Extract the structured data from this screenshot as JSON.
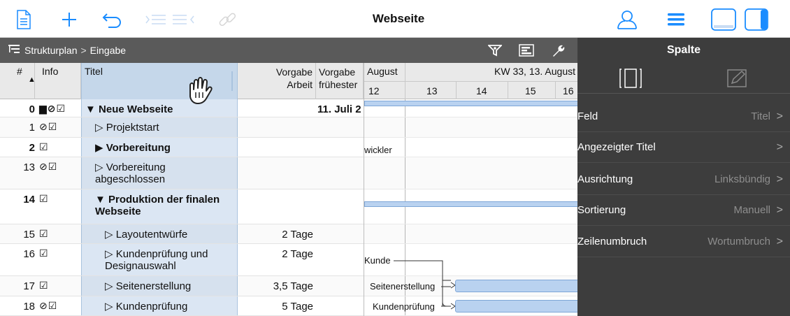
{
  "document": {
    "title": "Webseite"
  },
  "toolbar": {
    "left_icons": [
      "document-icon",
      "add-icon",
      "undo-icon",
      "indent-outdent-icon",
      "link-icon"
    ],
    "right_icons": [
      "resources-icon",
      "menu-icon",
      "bottom-pane-icon",
      "right-pane-icon"
    ],
    "accent_color": "#1a8cff"
  },
  "path": {
    "root": "Strukturplan",
    "separator": ">",
    "current": "Eingabe"
  },
  "table": {
    "columns": {
      "num": "#",
      "info": "Info",
      "title": "Titel",
      "work_line1": "Vorgabe",
      "work_line2": "Arbeit",
      "earliest_line1": "Vorgabe",
      "earliest_line2": "frühester"
    },
    "rows": [
      {
        "num": "0",
        "info": "▆⊘☑",
        "title": "▼ Neue Webseite",
        "work": "",
        "earliest": "11. Juli 2",
        "bold": true
      },
      {
        "num": "1",
        "info": "⊘☑",
        "title": "▷ Projektstart",
        "work": "",
        "earliest": "",
        "bold": false
      },
      {
        "num": "2",
        "info": "☑",
        "title": "▶ Vorbereitung",
        "work": "",
        "earliest": "",
        "bold": true
      },
      {
        "num": "13",
        "info": "⊘☑",
        "title": "▷ Vorbereitung abgeschlossen",
        "work": "",
        "earliest": "",
        "bold": false
      },
      {
        "num": "14",
        "info": "☑",
        "title": "▼ Produktion der finalen Webseite",
        "work": "",
        "earliest": "",
        "bold": true
      },
      {
        "num": "15",
        "info": "☑",
        "title": "▷ Layoutentwürfe",
        "work": "2 Tage",
        "earliest": "",
        "bold": false
      },
      {
        "num": "16",
        "info": "☑",
        "title": "▷ Kundenprüfung und Designauswahl",
        "work": "2 Tage",
        "earliest": "",
        "bold": false
      },
      {
        "num": "17",
        "info": "☑",
        "title": "▷ Seitenerstellung",
        "work": "3,5 Tage",
        "earliest": "",
        "bold": false
      },
      {
        "num": "18",
        "info": "⊘☑",
        "title": "▷ Kundenprüfung",
        "work": "5 Tage",
        "earliest": "",
        "bold": false
      }
    ]
  },
  "gantt": {
    "month_left": "August",
    "month_right": "KW 33, 13. August",
    "days": [
      "12",
      "13",
      "14",
      "15",
      "16"
    ],
    "labels": {
      "row2": "wickler",
      "row16": "Kunde",
      "row17": "Seitenerstellung",
      "row18": "Kundenprüfung"
    }
  },
  "inspector": {
    "title": "Spalte",
    "rows": [
      {
        "label": "Feld",
        "value": "Titel"
      },
      {
        "label": "Angezeigter Titel",
        "value": ""
      },
      {
        "label": "Ausrichtung",
        "value": "Linksbündig"
      },
      {
        "label": "Sortierung",
        "value": "Manuell"
      },
      {
        "label": "Zeilenumbruch",
        "value": "Wortumbruch"
      }
    ]
  }
}
